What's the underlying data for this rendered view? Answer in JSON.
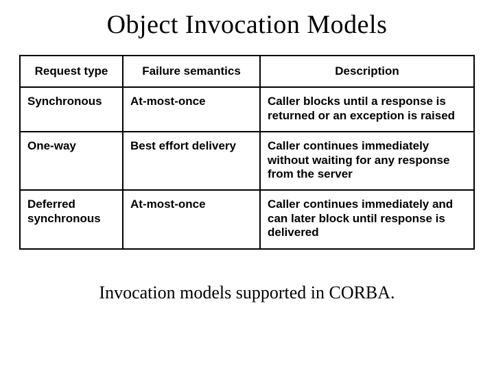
{
  "title": "Object Invocation Models",
  "table": {
    "headers": {
      "request_type": "Request type",
      "failure_semantics": "Failure semantics",
      "description": "Description"
    },
    "rows": [
      {
        "request_type": "Synchronous",
        "failure_semantics": "At-most-once",
        "description": "Caller blocks until a response is returned or an exception is raised"
      },
      {
        "request_type": "One-way",
        "failure_semantics": "Best effort delivery",
        "description": "Caller continues immediately without waiting for any response from the server"
      },
      {
        "request_type": "Deferred synchronous",
        "failure_semantics": "At-most-once",
        "description": "Caller continues immediately and can later block until response is delivered"
      }
    ]
  },
  "caption": "Invocation models supported in CORBA."
}
